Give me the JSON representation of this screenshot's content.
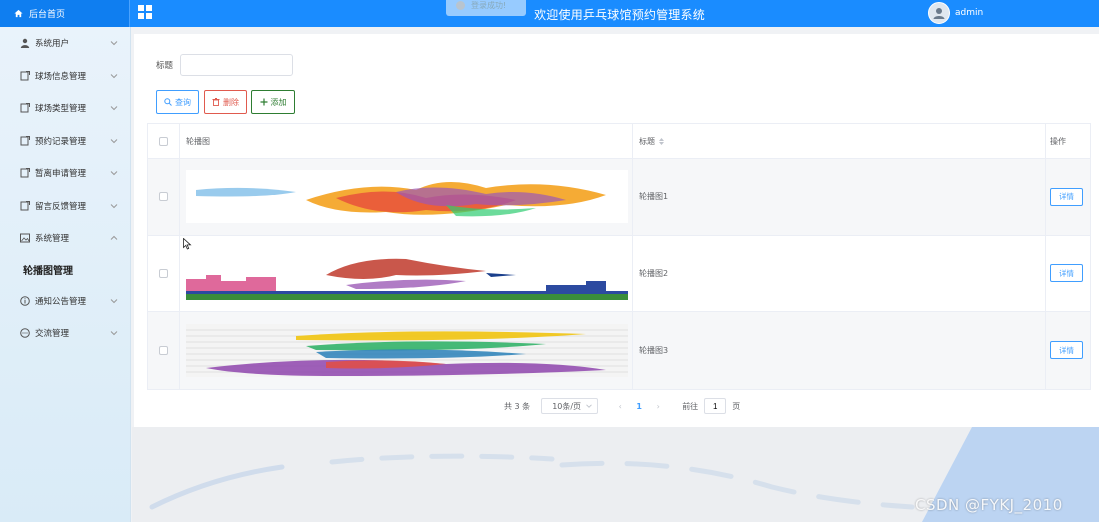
{
  "header": {
    "home_label": "后台首页",
    "title": "欢迎使用乒乓球馆预约管理系统",
    "toast_text": "登录成功!",
    "username": "admin"
  },
  "sidebar": {
    "items": [
      {
        "label": "系统用户",
        "icon": "user-icon",
        "expanded": false
      },
      {
        "label": "球场信息管理",
        "icon": "document-icon",
        "expanded": false
      },
      {
        "label": "球场类型管理",
        "icon": "document-icon",
        "expanded": false
      },
      {
        "label": "预约记录管理",
        "icon": "document-icon",
        "expanded": false
      },
      {
        "label": "暂离申请管理",
        "icon": "document-icon",
        "expanded": false
      },
      {
        "label": "留言反馈管理",
        "icon": "document-icon",
        "expanded": false
      },
      {
        "label": "系统管理",
        "icon": "picture-icon",
        "expanded": true
      },
      {
        "label": "轮播图管理",
        "icon": "",
        "submenu": true
      },
      {
        "label": "通知公告管理",
        "icon": "info-icon",
        "expanded": false
      },
      {
        "label": "交流管理",
        "icon": "chat-icon",
        "expanded": false
      }
    ]
  },
  "search": {
    "label": "标题",
    "value": "",
    "placeholder": ""
  },
  "buttons": {
    "query": "查询",
    "delete": "删除",
    "add": "添加"
  },
  "table": {
    "headers": {
      "image": "轮播图",
      "title": "标题",
      "operation": "操作"
    },
    "rows": [
      {
        "title": "轮播图1",
        "action": "详情"
      },
      {
        "title": "轮播图2",
        "action": "详情"
      },
      {
        "title": "轮播图3",
        "action": "详情"
      }
    ]
  },
  "pagination": {
    "total_text": "共 3 条",
    "page_size": "10条/页",
    "current_page": "1",
    "goto_label": "前往",
    "goto_value": "1",
    "page_suffix": "页"
  },
  "watermark": "CSDN @FYKJ_2010",
  "colors": {
    "header": "#1a8cff",
    "primary": "#409eff",
    "danger": "#e05a4e",
    "success": "#2e7d32"
  }
}
